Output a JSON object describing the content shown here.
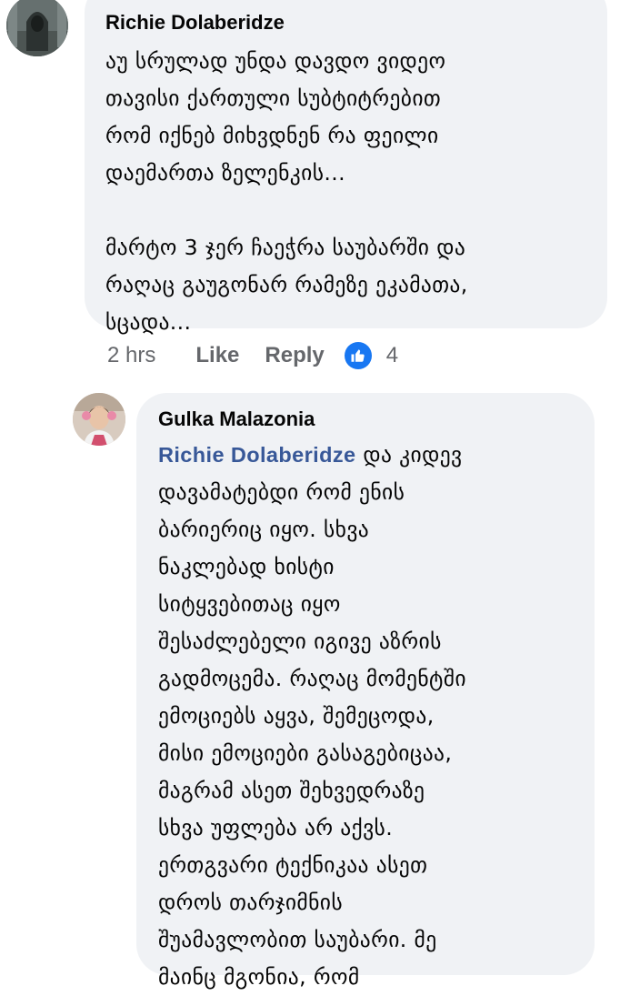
{
  "comments": [
    {
      "author": "Richie Dolaberidze",
      "text": "აუ სრულად უნდა დავდო ვიდეო\nთავისი ქართული სუბტიტრებით\nრომ იქნებ მიხვდნენ რა ფეილი\nდაემართა ზელენკის...\n\nმარტო 3 ჯერ ჩაეჭრა საუბარში და\nრაღაც გაუგონარ რამეზე ეკამათა,\nსცადა...",
      "time": "2 hrs",
      "like_label": "Like",
      "reply_label": "Reply",
      "reaction_count": "4"
    },
    {
      "author": "Gulka Malazonia",
      "mention": "Richie Dolaberidze",
      "text": " და კიდევ\nდავამატებდი რომ ენის\nბარიერიც იყო. სხვა\nნაკლებად ხისტი\nსიტყვებითაც იყო\nშესაძლებელი იგივე აზრის\nგადმოცემა. რაღაც მომენტში\nემოციებს აყვა, შემეცოდა,\nმისი ემოციები გასაგებიცაა,\nმაგრამ ასეთ შეხვედრაზე\nსხვა უფლება არ აქვს.\nერთგვარი ტექნიკაა ასეთ\nდროს თარჯიმნის\nშუამავლობით საუბარი. მე\nმაინც მგონია, რომ"
    }
  ],
  "colors": {
    "bubble": "#f0f2f5",
    "mention": "#385898",
    "meta": "#65676b",
    "like": "#1877f2"
  },
  "icons": {
    "reaction": "thumbs-up-icon"
  }
}
